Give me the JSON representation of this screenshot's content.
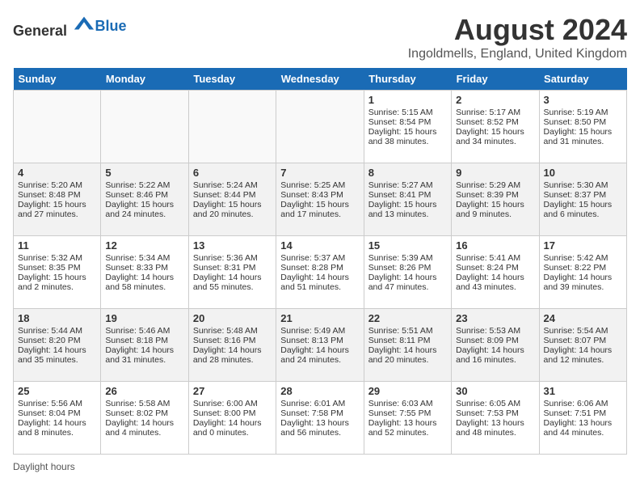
{
  "header": {
    "logo_general": "General",
    "logo_blue": "Blue",
    "month_year": "August 2024",
    "location": "Ingoldmells, England, United Kingdom"
  },
  "footer": {
    "daylight_label": "Daylight hours"
  },
  "days_of_week": [
    "Sunday",
    "Monday",
    "Tuesday",
    "Wednesday",
    "Thursday",
    "Friday",
    "Saturday"
  ],
  "weeks": [
    [
      {
        "day": "",
        "sunrise": "",
        "sunset": "",
        "daylight": ""
      },
      {
        "day": "",
        "sunrise": "",
        "sunset": "",
        "daylight": ""
      },
      {
        "day": "",
        "sunrise": "",
        "sunset": "",
        "daylight": ""
      },
      {
        "day": "",
        "sunrise": "",
        "sunset": "",
        "daylight": ""
      },
      {
        "day": "1",
        "sunrise": "Sunrise: 5:15 AM",
        "sunset": "Sunset: 8:54 PM",
        "daylight": "Daylight: 15 hours and 38 minutes."
      },
      {
        "day": "2",
        "sunrise": "Sunrise: 5:17 AM",
        "sunset": "Sunset: 8:52 PM",
        "daylight": "Daylight: 15 hours and 34 minutes."
      },
      {
        "day": "3",
        "sunrise": "Sunrise: 5:19 AM",
        "sunset": "Sunset: 8:50 PM",
        "daylight": "Daylight: 15 hours and 31 minutes."
      }
    ],
    [
      {
        "day": "4",
        "sunrise": "Sunrise: 5:20 AM",
        "sunset": "Sunset: 8:48 PM",
        "daylight": "Daylight: 15 hours and 27 minutes."
      },
      {
        "day": "5",
        "sunrise": "Sunrise: 5:22 AM",
        "sunset": "Sunset: 8:46 PM",
        "daylight": "Daylight: 15 hours and 24 minutes."
      },
      {
        "day": "6",
        "sunrise": "Sunrise: 5:24 AM",
        "sunset": "Sunset: 8:44 PM",
        "daylight": "Daylight: 15 hours and 20 minutes."
      },
      {
        "day": "7",
        "sunrise": "Sunrise: 5:25 AM",
        "sunset": "Sunset: 8:43 PM",
        "daylight": "Daylight: 15 hours and 17 minutes."
      },
      {
        "day": "8",
        "sunrise": "Sunrise: 5:27 AM",
        "sunset": "Sunset: 8:41 PM",
        "daylight": "Daylight: 15 hours and 13 minutes."
      },
      {
        "day": "9",
        "sunrise": "Sunrise: 5:29 AM",
        "sunset": "Sunset: 8:39 PM",
        "daylight": "Daylight: 15 hours and 9 minutes."
      },
      {
        "day": "10",
        "sunrise": "Sunrise: 5:30 AM",
        "sunset": "Sunset: 8:37 PM",
        "daylight": "Daylight: 15 hours and 6 minutes."
      }
    ],
    [
      {
        "day": "11",
        "sunrise": "Sunrise: 5:32 AM",
        "sunset": "Sunset: 8:35 PM",
        "daylight": "Daylight: 15 hours and 2 minutes."
      },
      {
        "day": "12",
        "sunrise": "Sunrise: 5:34 AM",
        "sunset": "Sunset: 8:33 PM",
        "daylight": "Daylight: 14 hours and 58 minutes."
      },
      {
        "day": "13",
        "sunrise": "Sunrise: 5:36 AM",
        "sunset": "Sunset: 8:31 PM",
        "daylight": "Daylight: 14 hours and 55 minutes."
      },
      {
        "day": "14",
        "sunrise": "Sunrise: 5:37 AM",
        "sunset": "Sunset: 8:28 PM",
        "daylight": "Daylight: 14 hours and 51 minutes."
      },
      {
        "day": "15",
        "sunrise": "Sunrise: 5:39 AM",
        "sunset": "Sunset: 8:26 PM",
        "daylight": "Daylight: 14 hours and 47 minutes."
      },
      {
        "day": "16",
        "sunrise": "Sunrise: 5:41 AM",
        "sunset": "Sunset: 8:24 PM",
        "daylight": "Daylight: 14 hours and 43 minutes."
      },
      {
        "day": "17",
        "sunrise": "Sunrise: 5:42 AM",
        "sunset": "Sunset: 8:22 PM",
        "daylight": "Daylight: 14 hours and 39 minutes."
      }
    ],
    [
      {
        "day": "18",
        "sunrise": "Sunrise: 5:44 AM",
        "sunset": "Sunset: 8:20 PM",
        "daylight": "Daylight: 14 hours and 35 minutes."
      },
      {
        "day": "19",
        "sunrise": "Sunrise: 5:46 AM",
        "sunset": "Sunset: 8:18 PM",
        "daylight": "Daylight: 14 hours and 31 minutes."
      },
      {
        "day": "20",
        "sunrise": "Sunrise: 5:48 AM",
        "sunset": "Sunset: 8:16 PM",
        "daylight": "Daylight: 14 hours and 28 minutes."
      },
      {
        "day": "21",
        "sunrise": "Sunrise: 5:49 AM",
        "sunset": "Sunset: 8:13 PM",
        "daylight": "Daylight: 14 hours and 24 minutes."
      },
      {
        "day": "22",
        "sunrise": "Sunrise: 5:51 AM",
        "sunset": "Sunset: 8:11 PM",
        "daylight": "Daylight: 14 hours and 20 minutes."
      },
      {
        "day": "23",
        "sunrise": "Sunrise: 5:53 AM",
        "sunset": "Sunset: 8:09 PM",
        "daylight": "Daylight: 14 hours and 16 minutes."
      },
      {
        "day": "24",
        "sunrise": "Sunrise: 5:54 AM",
        "sunset": "Sunset: 8:07 PM",
        "daylight": "Daylight: 14 hours and 12 minutes."
      }
    ],
    [
      {
        "day": "25",
        "sunrise": "Sunrise: 5:56 AM",
        "sunset": "Sunset: 8:04 PM",
        "daylight": "Daylight: 14 hours and 8 minutes."
      },
      {
        "day": "26",
        "sunrise": "Sunrise: 5:58 AM",
        "sunset": "Sunset: 8:02 PM",
        "daylight": "Daylight: 14 hours and 4 minutes."
      },
      {
        "day": "27",
        "sunrise": "Sunrise: 6:00 AM",
        "sunset": "Sunset: 8:00 PM",
        "daylight": "Daylight: 14 hours and 0 minutes."
      },
      {
        "day": "28",
        "sunrise": "Sunrise: 6:01 AM",
        "sunset": "Sunset: 7:58 PM",
        "daylight": "Daylight: 13 hours and 56 minutes."
      },
      {
        "day": "29",
        "sunrise": "Sunrise: 6:03 AM",
        "sunset": "Sunset: 7:55 PM",
        "daylight": "Daylight: 13 hours and 52 minutes."
      },
      {
        "day": "30",
        "sunrise": "Sunrise: 6:05 AM",
        "sunset": "Sunset: 7:53 PM",
        "daylight": "Daylight: 13 hours and 48 minutes."
      },
      {
        "day": "31",
        "sunrise": "Sunrise: 6:06 AM",
        "sunset": "Sunset: 7:51 PM",
        "daylight": "Daylight: 13 hours and 44 minutes."
      }
    ]
  ]
}
